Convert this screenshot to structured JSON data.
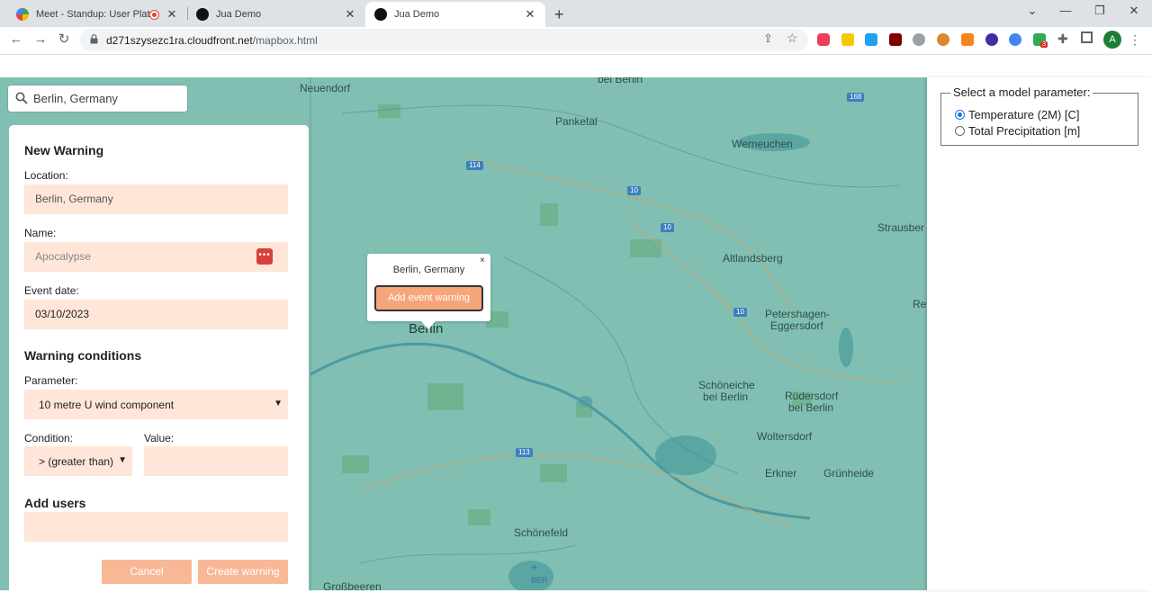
{
  "browser": {
    "tabs": [
      {
        "title": "Meet - Standup: User Platfor",
        "icon": "google-meet-icon",
        "active": false
      },
      {
        "title": "Jua Demo",
        "icon": "jua-icon",
        "active": false
      },
      {
        "title": "Jua Demo",
        "icon": "jua-icon",
        "active": true
      }
    ],
    "new_tab": "+",
    "url_host": "d271szysezc1ra.cloudfront.net",
    "url_path": "/mapbox.html",
    "profile_initial": "A",
    "extension_badge": "3"
  },
  "search": {
    "value": "Berlin, Germany"
  },
  "warning_form": {
    "title": "New Warning",
    "location_label": "Location:",
    "location_value": "Berlin, Germany",
    "name_label": "Name:",
    "name_placeholder": "Apocalypse",
    "date_label": "Event date:",
    "date_value": "03/10/2023",
    "conditions_title": "Warning conditions",
    "parameter_label": "Parameter:",
    "parameter_value": "10 metre U wind component",
    "condition_label": "Condition:",
    "condition_value": "> (greater than)",
    "value_label": "Value:",
    "users_title": "Add users",
    "cancel_label": "Cancel",
    "create_label": "Create warning"
  },
  "popup": {
    "title": "Berlin, Germany",
    "button": "Add event warning",
    "close": "×"
  },
  "map": {
    "labels": [
      {
        "text": "Neuendorf"
      },
      {
        "text": "bei Berlin"
      },
      {
        "text": "Panketal"
      },
      {
        "text": "Werneuchen"
      },
      {
        "text": "Strausber"
      },
      {
        "text": "Altlandsberg"
      },
      {
        "text": "Petershagen-"
      },
      {
        "text": "Eggersdorf"
      },
      {
        "text": "Rei"
      },
      {
        "text": "Schöneiche"
      },
      {
        "text": "bei Berlin"
      },
      {
        "text": "Rüdersdorf"
      },
      {
        "text": "bei Berlin"
      },
      {
        "text": "Woltersdorf"
      },
      {
        "text": "Erkner"
      },
      {
        "text": "Grünheide"
      },
      {
        "text": "Schönefeld"
      },
      {
        "text": "BER"
      },
      {
        "text": "Großbeeren"
      }
    ],
    "city": "Berlin",
    "shields": [
      "114",
      "10",
      "10",
      "10",
      "113",
      "168"
    ]
  },
  "model_panel": {
    "legend": "Select a model parameter:",
    "options": [
      {
        "label": "Temperature (2M) [C]",
        "selected": true
      },
      {
        "label": "Total Precipitation [m]",
        "selected": false
      }
    ]
  }
}
